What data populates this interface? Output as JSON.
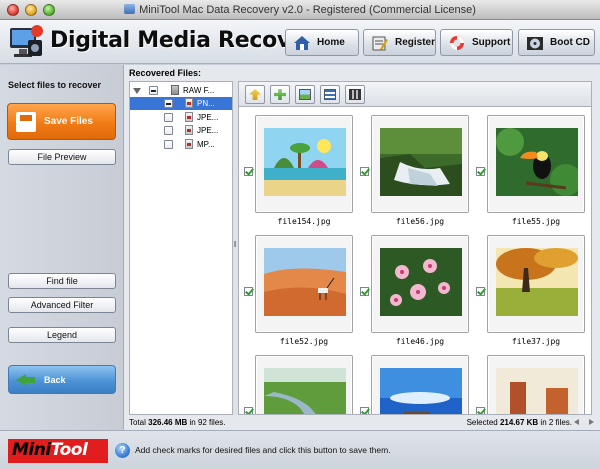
{
  "window": {
    "title": "MiniTool Mac Data Recovery v2.0 - Registered (Commercial License)"
  },
  "header": {
    "app_name": "Digital Media Recovery",
    "nav": [
      {
        "label": "Home",
        "icon": "home-icon"
      },
      {
        "label": "Register",
        "icon": "register-icon"
      },
      {
        "label": "Support",
        "icon": "support-lifebuoy-icon"
      },
      {
        "label": "Boot CD",
        "icon": "boot-cd-icon"
      }
    ]
  },
  "left_panel": {
    "heading": "Select files to recover",
    "save_label": "Save Files",
    "preview_label": "File Preview",
    "find_label": "Find file",
    "filter_label": "Advanced Filter",
    "legend_label": "Legend",
    "back_label": "Back"
  },
  "main": {
    "heading": "Recovered Files:",
    "tree": [
      {
        "label": "RAW F...",
        "level": 0,
        "expanded": true,
        "checked": "partial",
        "selected": false
      },
      {
        "label": "PN...",
        "level": 1,
        "checked": "partial",
        "selected": true
      },
      {
        "label": "JPE...",
        "level": 1,
        "checked": "none",
        "selected": false
      },
      {
        "label": "JPE...",
        "level": 1,
        "checked": "none",
        "selected": false
      },
      {
        "label": "MP...",
        "level": 1,
        "checked": "none",
        "selected": false
      }
    ],
    "toolbar": [
      {
        "icon": "up-folder-icon"
      },
      {
        "icon": "add-icon"
      },
      {
        "icon": "thumbnail-view-icon"
      },
      {
        "icon": "list-view-icon"
      },
      {
        "icon": "filmstrip-view-icon"
      }
    ],
    "thumbnails": [
      {
        "name": "file154.jpg",
        "checked": true,
        "scene": "cartoon-beach"
      },
      {
        "name": "file56.jpg",
        "checked": true,
        "scene": "waterfall"
      },
      {
        "name": "file55.jpg",
        "checked": true,
        "scene": "toucan"
      },
      {
        "name": "file52.jpg",
        "checked": true,
        "scene": "desert-oryx"
      },
      {
        "name": "file46.jpg",
        "checked": true,
        "scene": "pink-flowers"
      },
      {
        "name": "file37.jpg",
        "checked": true,
        "scene": "autumn-tree"
      },
      {
        "name": "",
        "checked": true,
        "scene": "river-meadow"
      },
      {
        "name": "",
        "checked": true,
        "scene": "blue-sea"
      },
      {
        "name": "",
        "checked": true,
        "scene": "canyon"
      }
    ],
    "status_total_prefix": "Total ",
    "status_total_size": "326.46 MB",
    "status_total_suffix": " in 92 files.",
    "status_selected_prefix": "Selected ",
    "status_selected_size": "214.67 KB",
    "status_selected_suffix": " in 2 files."
  },
  "bottom": {
    "brand_part1": "Mini",
    "brand_part2": "Tool",
    "help_glyph": "?",
    "hint": "Add check marks for desired files and click this button to save them."
  },
  "colors": {
    "save_orange": "#f07b16",
    "back_blue": "#4e93d6",
    "selection_blue": "#3875d7",
    "brand_red": "#e21d1d"
  }
}
